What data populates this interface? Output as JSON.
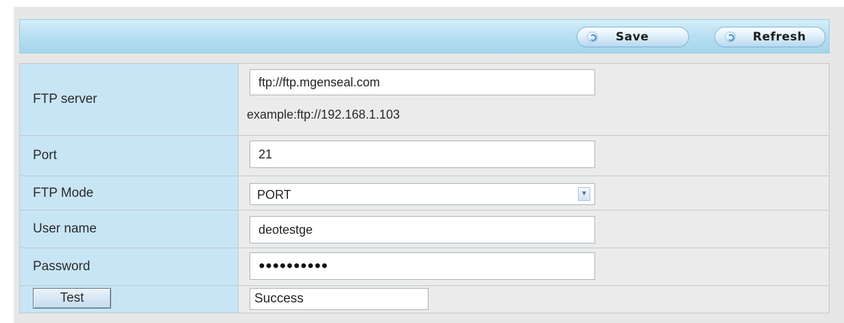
{
  "toolbar": {
    "save_label": "Save",
    "refresh_label": "Refresh"
  },
  "form": {
    "ftp_server": {
      "label": "FTP server",
      "value": "ftp://ftp.mgenseal.com",
      "hint": "example:ftp://192.168.1.103"
    },
    "port": {
      "label": "Port",
      "value": "21"
    },
    "ftp_mode": {
      "label": "FTP Mode",
      "selected": "PORT"
    },
    "user_name": {
      "label": "User name",
      "value": "deotestge"
    },
    "password": {
      "label": "Password",
      "masked_value": "●●●●●●●●●●"
    },
    "test": {
      "button_label": "Test",
      "result": "Success"
    }
  },
  "icons": {
    "toolbar_button_icon": "refresh-circle-icon",
    "select_arrow_icon": "chevron-down-icon"
  }
}
